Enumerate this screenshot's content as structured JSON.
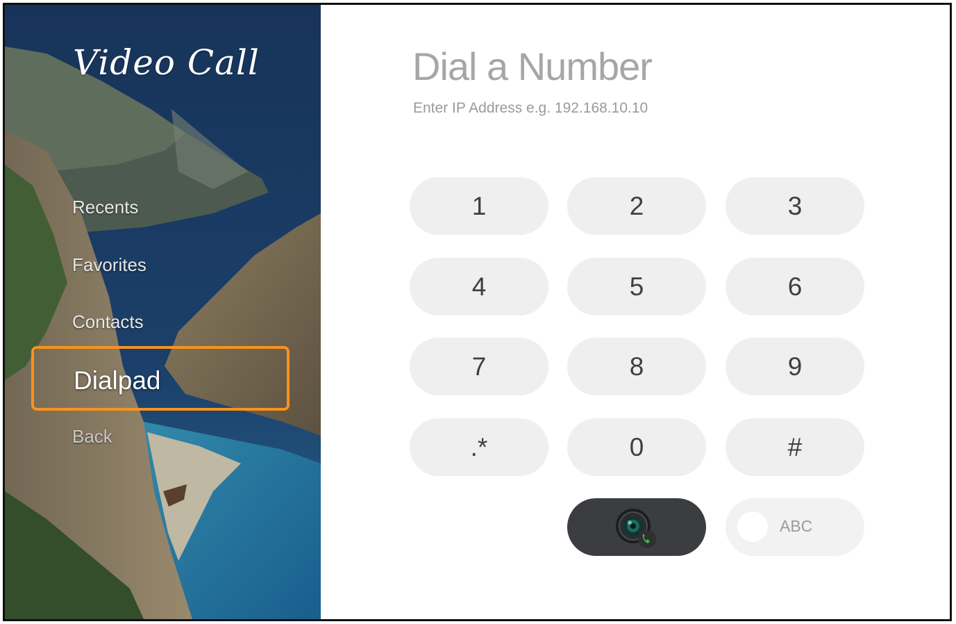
{
  "app": {
    "brand": "Video Call"
  },
  "sidebar": {
    "items": [
      {
        "label": "Recents"
      },
      {
        "label": "Favorites"
      },
      {
        "label": "Contacts"
      },
      {
        "label": "Dialpad",
        "active": true
      },
      {
        "label": "Back"
      }
    ],
    "active_color": "#f7931e"
  },
  "main": {
    "title": "Dial a Number",
    "subtitle": "Enter IP Address e.g. 192.168.10.10"
  },
  "keypad": {
    "keys": [
      {
        "label": "1"
      },
      {
        "label": "2"
      },
      {
        "label": "3"
      },
      {
        "label": "4"
      },
      {
        "label": "5"
      },
      {
        "label": "6"
      },
      {
        "label": "7"
      },
      {
        "label": "8"
      },
      {
        "label": "9"
      },
      {
        "label": ".*"
      },
      {
        "label": "0"
      },
      {
        "label": "#"
      }
    ],
    "call_button_icon": "video-call-camera-icon",
    "toggle_label": "ABC",
    "toggle_on": false,
    "colors": {
      "key_background": "#efefef",
      "call_background": "#3b3d40",
      "phone_accent": "#3ec43e"
    }
  }
}
